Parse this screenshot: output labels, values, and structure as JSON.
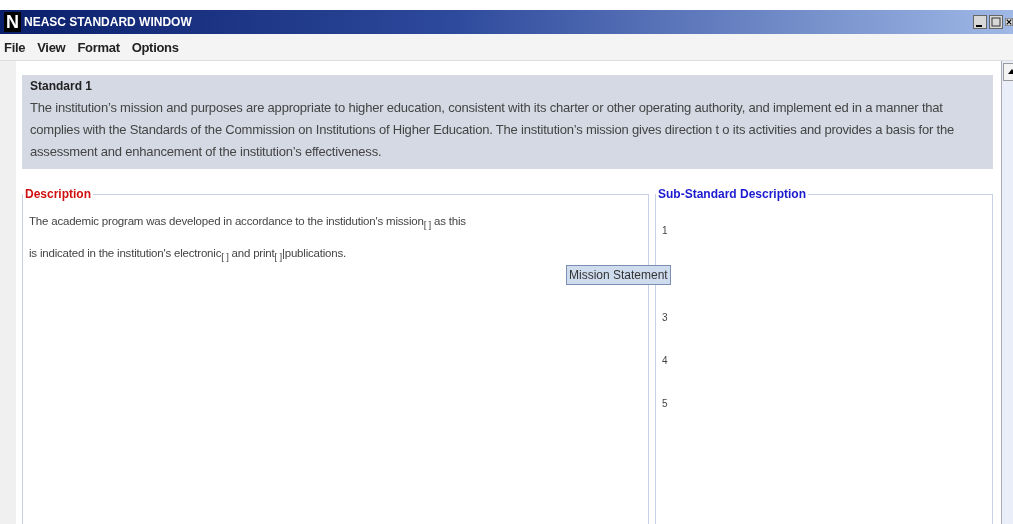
{
  "window": {
    "title": "NEASC STANDARD WINDOW",
    "logo": "N"
  },
  "menu": [
    "File",
    "View",
    "Format",
    "Options"
  ],
  "standard": {
    "title": "Standard 1",
    "text": "The institution’s mission and purposes are appropriate to higher education, consistent with its charter or other operating authority, and implement ed in a manner that complies with the Standards of the Commission on Institutions of Higher Education. The institution’s mission gives direction t o its activities and provides a basis for the assessment and enhancement of the institution’s effectiveness."
  },
  "description": {
    "legend": "Description",
    "lines": [
      "The academic program was developed in accordance to the instidution's mission$_{[ ]}$ as this",
      "is indicated in the institution's electronic$_{[ ]}$ and print$_{[ ]}$|publications."
    ]
  },
  "tooltip": "Mission Statement",
  "sub_standard": {
    "legend": "Sub-Standard Description",
    "items": [
      "1",
      "3",
      "4",
      "5"
    ]
  }
}
